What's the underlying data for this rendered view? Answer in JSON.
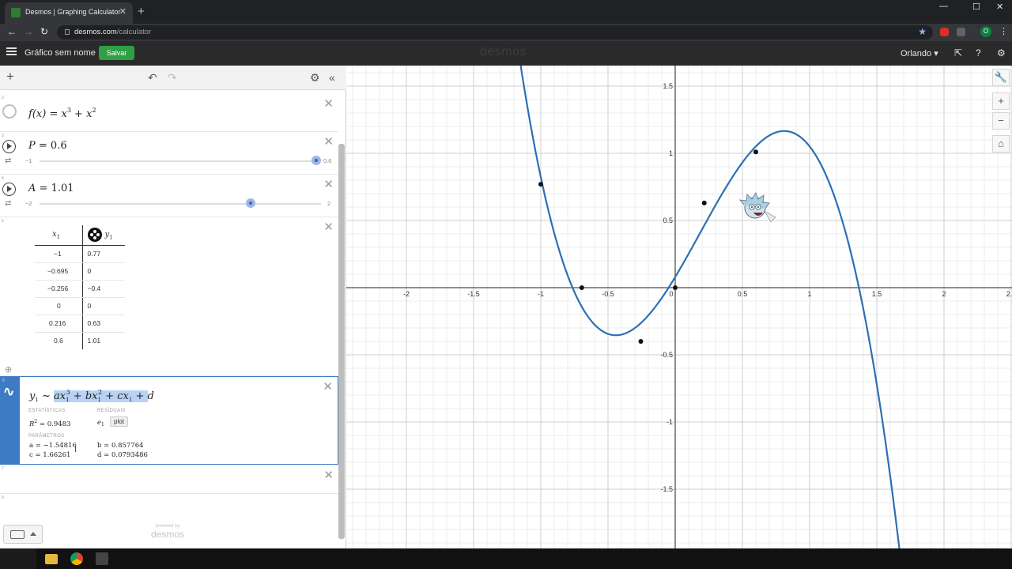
{
  "browser": {
    "tab_title": "Desmos | Graphing Calculator",
    "tab_close": "✕",
    "new_tab": "+",
    "url_domain": "desmos.com",
    "url_path": "/calculator",
    "profile_initial": "O",
    "win_minimize": "—",
    "win_maximize": "☐",
    "win_close": "✕"
  },
  "header": {
    "graph_title": "Gráfico sem nome",
    "save_label": "Salvar",
    "wordmark": "desmos",
    "user": "Orlando ▾"
  },
  "expressions": {
    "e2": {
      "index": "2",
      "f": "f",
      "x": "x",
      "eq": " = ",
      "xa": "x",
      "ea": "3",
      "plus": " + ",
      "xb": "x",
      "eb": "2"
    },
    "e3": {
      "index": "3",
      "lhs": "P",
      "eq": " = ",
      "value": "0.6",
      "min": "−1",
      "max": "0.6",
      "level": 1.0
    },
    "e4": {
      "index": "4",
      "lhs": "A",
      "eq": " = ",
      "value": "1.01",
      "min": "−2",
      "max": "2",
      "level": 0.7525
    },
    "e5": {
      "index": "5",
      "col1_var": "x",
      "col1_sub": "1",
      "col2_var": "y",
      "col2_sub": "1",
      "rows": [
        [
          "−1",
          "0.77"
        ],
        [
          "−0.695",
          "0"
        ],
        [
          "−0.256",
          "−0.4"
        ],
        [
          "0",
          "0"
        ],
        [
          "0.216",
          "0.63"
        ],
        [
          "0.6",
          "1.01"
        ]
      ]
    },
    "e6": {
      "index": "6",
      "lhs": "y",
      "lhs_sub": "1",
      "tilde": " ~ ",
      "a": "a",
      "x1": "x",
      "s1": "1",
      "p1": "3",
      "plus1": " + ",
      "b": "b",
      "x2": "x",
      "s2": "1",
      "p2": "2",
      "plus2": " + ",
      "c": "c",
      "x3": "x",
      "s3": "1",
      "plus3": " + ",
      "d": "d",
      "stats_label": "ESTATÍSTICAS",
      "r2_label": "R",
      "r2_exp": "2",
      "r2_value": " = 0.9483",
      "residuals_label": "RESÍDUAIS",
      "residual_var": "e",
      "residual_sub": "1",
      "plot_label": "plot",
      "params_label": "PARÂMETROS",
      "param_a": "a = −1.54816",
      "param_b": "b = 0.857764",
      "param_c": "c = 1.66261",
      "param_d": "d = 0.0793486"
    },
    "e7": {
      "index": "7"
    },
    "e8": {
      "index": "8"
    }
  },
  "footer": {
    "powered_by": "powered by",
    "wordmark": "desmos"
  },
  "graph": {
    "x_ticks": [
      "-2",
      "-1.5",
      "-1",
      "-0.5",
      "0",
      "0.5",
      "1",
      "1.5",
      "2",
      "2.5"
    ],
    "y_ticks": [
      "1.5",
      "1",
      "0.5",
      "-0.5",
      "-1",
      "-1.5"
    ],
    "curve_color": "#2d70b3",
    "points_x": [
      -1,
      -0.695,
      -0.256,
      0,
      0.216,
      0.6
    ],
    "points_y": [
      0.77,
      0,
      -0.4,
      0,
      0.63,
      1.01
    ]
  },
  "graph_controls": {
    "wrench": "🔧",
    "zoom_in": "+",
    "zoom_out": "−",
    "home": "⌂"
  }
}
